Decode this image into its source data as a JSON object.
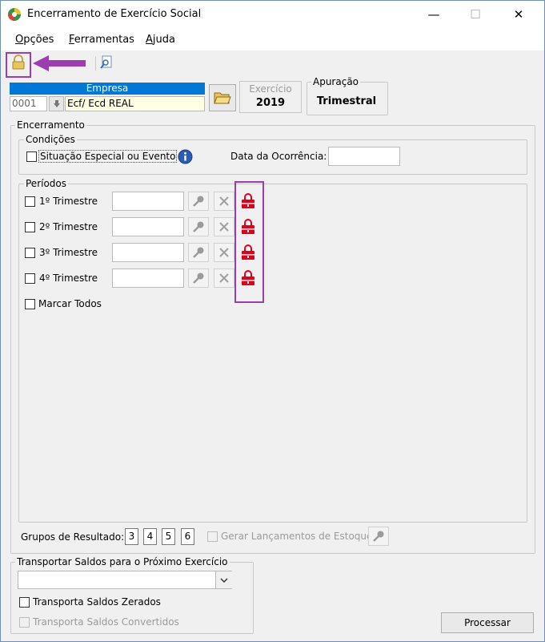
{
  "window": {
    "title": "Encerramento de Exercício Social",
    "minimize_glyph": "—",
    "maximize_glyph": "☐",
    "close_glyph": "✕"
  },
  "menu": [
    {
      "label": "Opções"
    },
    {
      "label": "Ferramentas"
    },
    {
      "label": "Ajuda"
    }
  ],
  "empresa": {
    "header": "Empresa",
    "code": "0001",
    "name": "Ecf/ Ecd REAL"
  },
  "exercicio": {
    "label": "Exercício",
    "value": "2019"
  },
  "apuracao": {
    "label": "Apuração",
    "value": "Trimestral"
  },
  "encerramento": {
    "label": "Encerramento",
    "condicoes": {
      "label": "Condições",
      "situacao_label": "Situação Especial ou Evento",
      "data_label": "Data da Ocorrência:",
      "data_value": ""
    },
    "periodos": {
      "label": "Períodos",
      "items": [
        {
          "label": "1º Trimestre",
          "value": ""
        },
        {
          "label": "2º Trimestre",
          "value": ""
        },
        {
          "label": "3º Trimestre",
          "value": ""
        },
        {
          "label": "4º Trimestre",
          "value": ""
        }
      ],
      "marcar_todos": "Marcar Todos"
    },
    "grupos_label": "Grupos de Resultado:",
    "grupos": [
      "3",
      "4",
      "5",
      "6"
    ],
    "gerar_label": "Gerar Lançamentos de Estoque"
  },
  "transportar": {
    "label": "Transportar Saldos para o Próximo Exercício",
    "selected": "",
    "zerados_label": "Transporta Saldos Zerados",
    "convertidos_label": "Transporta Saldos Convertidos"
  },
  "processar_label": "Processar",
  "colors": {
    "highlight": "#9b3fb0",
    "empresa_header": "#0078d7",
    "lock_red": "#e0001a"
  }
}
